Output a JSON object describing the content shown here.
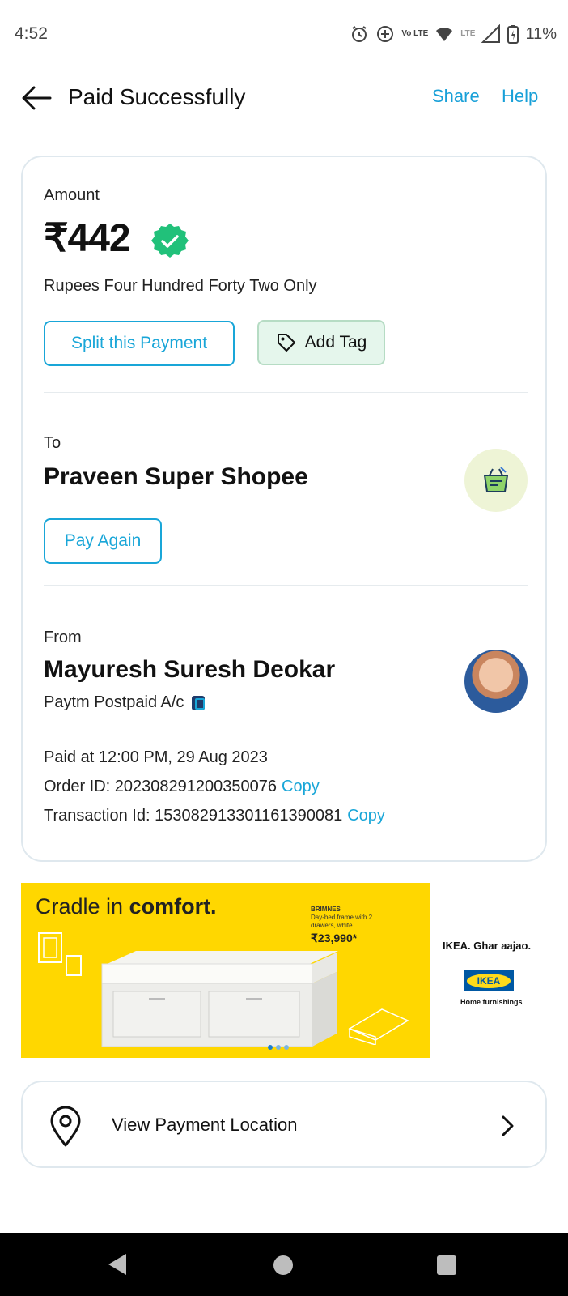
{
  "status_bar": {
    "time": "4:52",
    "volte_label": "Vo LTE",
    "lte_label": "LTE",
    "battery": "11%"
  },
  "header": {
    "title": "Paid Successfully",
    "share": "Share",
    "help": "Help"
  },
  "payment": {
    "amount_label": "Amount",
    "amount": "₹442",
    "amount_words": "Rupees Four Hundred Forty Two Only",
    "split_button": "Split this Payment",
    "tag_button": "Add Tag"
  },
  "to": {
    "label": "To",
    "name": "Praveen Super Shopee",
    "pay_again": "Pay Again"
  },
  "from": {
    "label": "From",
    "name": "Mayuresh Suresh Deokar",
    "account": "Paytm Postpaid A/c"
  },
  "details": {
    "paid_at": "Paid at 12:00 PM, 29 Aug 2023",
    "order_id": "Order ID: 202308291200350076",
    "transaction_id": "Transaction Id: 15308291330116139008​1",
    "copy": "Copy"
  },
  "banner": {
    "headline_a": "Cradle in ",
    "headline_b": "comfort.",
    "product_name": "BRIMNES",
    "product_desc": "Day-bed frame with 2 drawers, white",
    "price": "₹23,990*",
    "tagline": "IKEA. Ghar aajao.",
    "logo_text": "IKEA",
    "logo_sub": "Home furnishings"
  },
  "location": {
    "label": "View Payment Location"
  },
  "colors": {
    "accent": "#19a6d8",
    "verified": "#21c17a",
    "tag_bg": "#e5f6ec",
    "banner_bg": "#ffd700"
  },
  "icons": {
    "back": "arrow-left-icon",
    "verified": "verified-badge-icon",
    "tag": "tag-icon",
    "shop": "shopping-basket-icon",
    "pin": "location-pin-icon",
    "chevron": "chevron-right-icon"
  }
}
